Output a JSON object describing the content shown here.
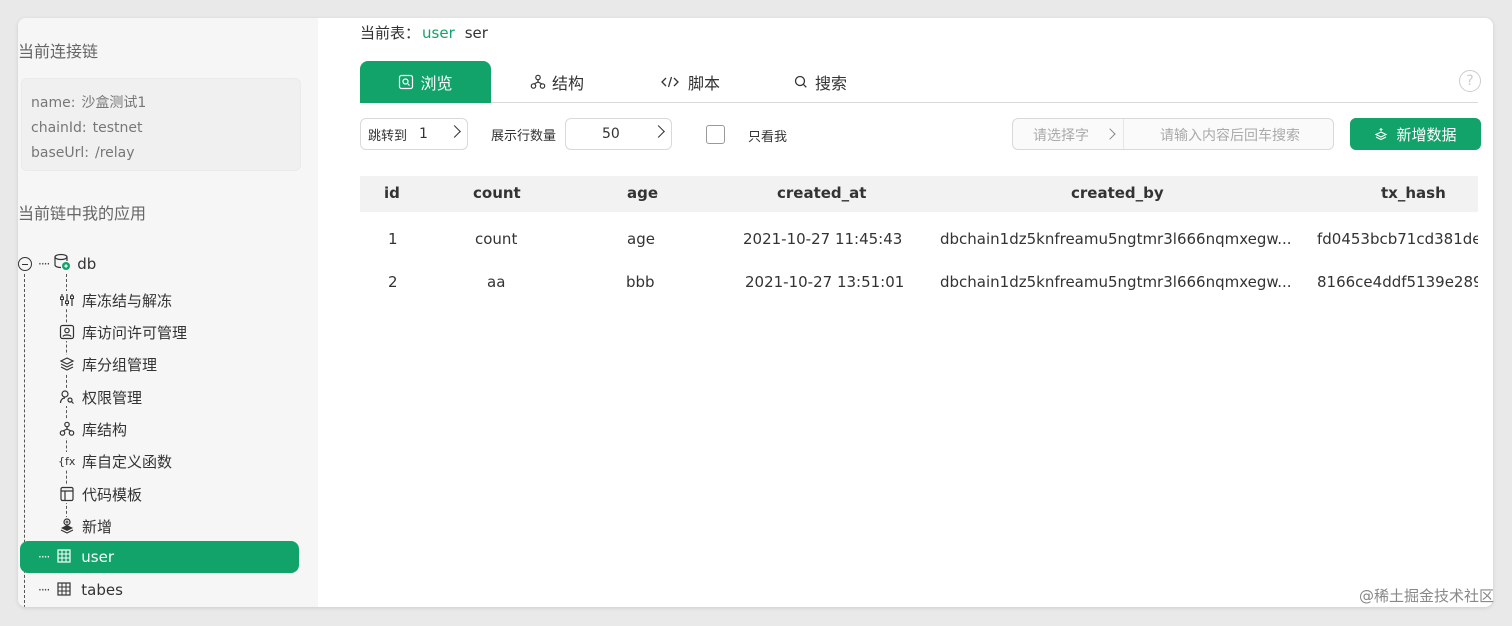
{
  "sidebar": {
    "conn_label": "当前连接链",
    "conn": [
      {
        "key": "name:",
        "value": "沙盒测试1"
      },
      {
        "key": "chainId:",
        "value": "testnet"
      },
      {
        "key": "baseUrl:",
        "value": "/relay"
      }
    ],
    "apps_label": "当前链中我的应用",
    "db": {
      "label": "db",
      "icon": "database-icon"
    },
    "menu": [
      {
        "label": "库冻结与解冻",
        "icon": "sliders-icon"
      },
      {
        "label": "库访问许可管理",
        "icon": "user-badge-icon"
      },
      {
        "label": "库分组管理",
        "icon": "layers-icon"
      },
      {
        "label": "权限管理",
        "icon": "user-key-icon"
      },
      {
        "label": "库结构",
        "icon": "hierarchy-icon"
      },
      {
        "label": "库自定义函数",
        "icon": "function-icon"
      },
      {
        "label": "代码模板",
        "icon": "template-icon"
      },
      {
        "label": "新增",
        "icon": "add-layer-icon"
      }
    ],
    "tables": [
      {
        "label": "user",
        "active": true
      },
      {
        "label": "tabes",
        "active": false
      }
    ]
  },
  "main": {
    "current_label": "当前表：",
    "current_table": "user",
    "current_extra": "ser",
    "tabs": [
      {
        "label": "浏览",
        "icon": "browse-icon"
      },
      {
        "label": "结构",
        "icon": "structure-icon"
      },
      {
        "label": "脚本",
        "icon": "code-icon"
      },
      {
        "label": "搜索",
        "icon": "search-icon"
      }
    ],
    "help": "?",
    "toolbar": {
      "jump_label": "跳转到",
      "jump_value": "1",
      "rows_label": "展示行数量",
      "rows_value": "50",
      "only_me_label": "只看我",
      "field_placeholder": "请选择字",
      "search_placeholder": "请输入内容后回车搜索",
      "add_label": "新增数据"
    },
    "table": {
      "columns": [
        "id",
        "count",
        "age",
        "created_at",
        "created_by",
        "tx_hash"
      ],
      "rows": [
        [
          "1",
          "count",
          "age",
          "2021-10-27 11:45:43",
          "dbchain1dz5knfreamu5ngtmr3l666nqmxegw...",
          "fd0453bcb71cd381de"
        ],
        [
          "2",
          "aa",
          "bbb",
          "2021-10-27 13:51:01",
          "dbchain1dz5knfreamu5ngtmr3l666nqmxegw...",
          "8166ce4ddf5139e289"
        ]
      ]
    }
  },
  "watermark": "@稀土掘金技术社区",
  "colors": {
    "accent": "#12a36a"
  }
}
